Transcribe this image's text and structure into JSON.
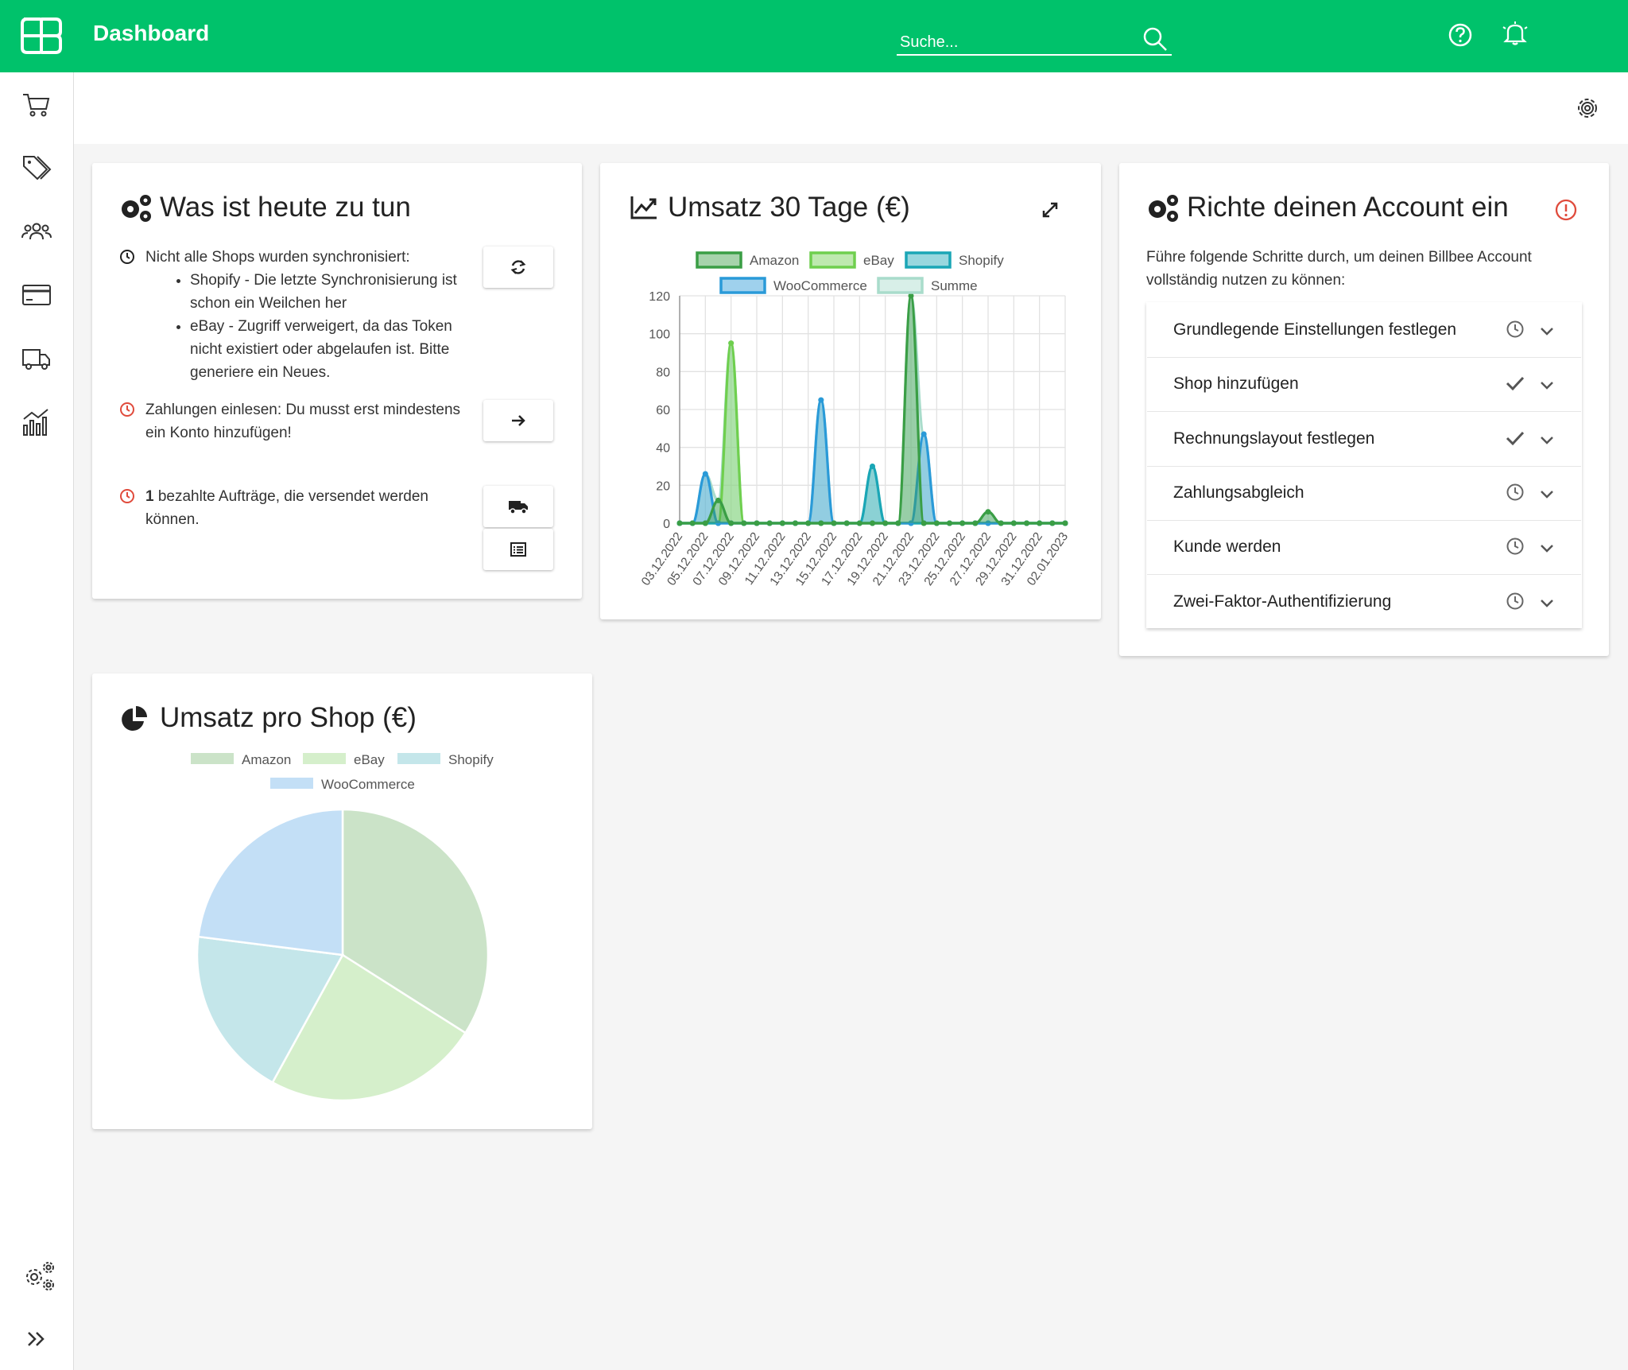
{
  "header": {
    "title": "Dashboard",
    "search_placeholder": "Suche..."
  },
  "colors": {
    "brand": "#00c26b",
    "amazon": "#3a9e45",
    "ebay": "#6fcf4e",
    "shopify": "#1aa6b6",
    "woocommerce": "#2a9ad8",
    "summe": "#a9dccb",
    "warn": "#e04b3c"
  },
  "todo": {
    "title": "Was ist heute zu tun",
    "sync_text": "Nicht alle Shops wurden synchronisiert:",
    "sync_items": [
      "Shopify - Die letzte Synchronisierung ist schon ein Weilchen her",
      "eBay - Zugriff verweigert, da das Token nicht existiert oder abgelaufen ist. Bitte generiere ein Neues."
    ],
    "payments_text": "Zahlungen einlesen: Du musst erst mindestens ein Konto hinzufügen!",
    "orders_count": "1",
    "orders_text": "bezahlte Aufträge, die versendet werden können."
  },
  "revenue": {
    "title": "Umsatz 30 Tage (€)"
  },
  "chart_data": [
    {
      "type": "area",
      "title": "Umsatz 30 Tage (€)",
      "legend": [
        "Amazon",
        "eBay",
        "Shopify",
        "WooCommerce",
        "Summe"
      ],
      "x": [
        "03.12.2022",
        "04.12.2022",
        "05.12.2022",
        "06.12.2022",
        "07.12.2022",
        "08.12.2022",
        "09.12.2022",
        "10.12.2022",
        "11.12.2022",
        "12.12.2022",
        "13.12.2022",
        "14.12.2022",
        "15.12.2022",
        "16.12.2022",
        "17.12.2022",
        "18.12.2022",
        "19.12.2022",
        "20.12.2022",
        "21.12.2022",
        "22.12.2022",
        "23.12.2022",
        "24.12.2022",
        "25.12.2022",
        "26.12.2022",
        "27.12.2022",
        "28.12.2022",
        "29.12.2022",
        "30.12.2022",
        "31.12.2022",
        "01.01.2023",
        "02.01.2023"
      ],
      "x_tick_labels": [
        "03.12.2022",
        "05.12.2022",
        "07.12.2022",
        "09.12.2022",
        "11.12.2022",
        "13.12.2022",
        "15.12.2022",
        "17.12.2022",
        "19.12.2022",
        "21.12.2022",
        "23.12.2022",
        "25.12.2022",
        "27.12.2022",
        "29.12.2022",
        "31.12.2022",
        "02.01.2023"
      ],
      "y_ticks": [
        0,
        20,
        40,
        60,
        80,
        100,
        120
      ],
      "ylim": [
        0,
        120
      ],
      "series": [
        {
          "name": "Amazon",
          "values": [
            0,
            0,
            0,
            12,
            0,
            0,
            0,
            0,
            0,
            0,
            0,
            0,
            0,
            0,
            0,
            0,
            0,
            0,
            120,
            0,
            0,
            0,
            0,
            0,
            6,
            0,
            0,
            0,
            0,
            0,
            0
          ]
        },
        {
          "name": "eBay",
          "values": [
            0,
            0,
            0,
            0,
            95,
            0,
            0,
            0,
            0,
            0,
            0,
            0,
            0,
            0,
            0,
            0,
            0,
            0,
            0,
            0,
            0,
            0,
            0,
            0,
            0,
            0,
            0,
            0,
            0,
            0,
            0
          ]
        },
        {
          "name": "Shopify",
          "values": [
            0,
            0,
            0,
            0,
            0,
            0,
            0,
            0,
            0,
            0,
            0,
            0,
            0,
            0,
            0,
            30,
            0,
            0,
            0,
            0,
            0,
            0,
            0,
            0,
            0,
            0,
            0,
            0,
            0,
            0,
            0
          ]
        },
        {
          "name": "WooCommerce",
          "values": [
            0,
            0,
            26,
            0,
            0,
            0,
            0,
            0,
            0,
            0,
            0,
            65,
            0,
            0,
            0,
            0,
            0,
            0,
            0,
            47,
            0,
            0,
            0,
            0,
            0,
            0,
            0,
            0,
            0,
            0,
            0
          ]
        },
        {
          "name": "Summe",
          "values": [
            0,
            0,
            26,
            12,
            95,
            0,
            0,
            0,
            0,
            0,
            0,
            65,
            0,
            0,
            0,
            30,
            0,
            0,
            120,
            47,
            0,
            0,
            0,
            0,
            6,
            0,
            0,
            0,
            0,
            0,
            0
          ]
        }
      ],
      "grid": true,
      "legend_position": "top"
    },
    {
      "type": "pie",
      "title": "Umsatz pro Shop (€)",
      "legend": [
        "Amazon",
        "eBay",
        "Shopify",
        "WooCommerce"
      ],
      "series": [
        {
          "name": "Amazon",
          "values": [
            34
          ]
        },
        {
          "name": "eBay",
          "values": [
            24
          ]
        },
        {
          "name": "Shopify",
          "values": [
            19
          ]
        },
        {
          "name": "WooCommerce",
          "values": [
            23
          ]
        }
      ],
      "legend_position": "top"
    }
  ],
  "account": {
    "title": "Richte deinen Account ein",
    "intro": "Führe folgende Schritte durch, um deinen Billbee Account vollständig nutzen zu können:",
    "steps": [
      {
        "label": "Grundlegende Einstellungen festlegen",
        "status": "clock-icon"
      },
      {
        "label": "Shop hinzufügen",
        "status": "check-icon"
      },
      {
        "label": "Rechnungslayout festlegen",
        "status": "check-icon"
      },
      {
        "label": "Zahlungsabgleich",
        "status": "clock-icon"
      },
      {
        "label": "Kunde werden",
        "status": "clock-icon"
      },
      {
        "label": "Zwei-Faktor-Authentifizierung",
        "status": "clock-icon"
      }
    ]
  },
  "shop_pie": {
    "title": "Umsatz pro Shop (€)"
  }
}
